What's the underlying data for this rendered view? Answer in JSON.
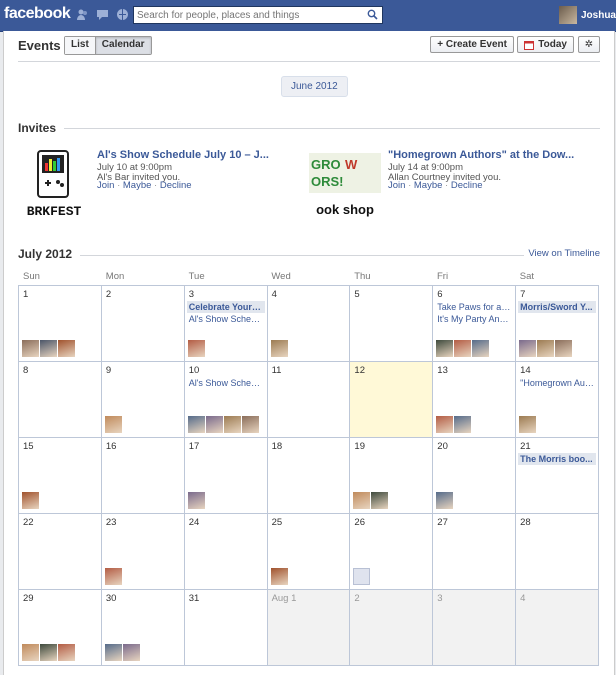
{
  "topbar": {
    "logo": "facebook",
    "search_placeholder": "Search for people, places and things",
    "profile_name": "Joshua",
    "icons": [
      "friend-requests-icon",
      "messages-icon",
      "notifications-icon",
      "search-icon"
    ]
  },
  "header": {
    "title": "Events",
    "view_list": "List",
    "view_calendar": "Calendar",
    "create_event": "+ Create Event",
    "today": "Today"
  },
  "month_pill": "June 2012",
  "invites": {
    "section_title": "Invites",
    "items": [
      {
        "title": "Al's Show Schedule July 10 – J...",
        "time": "July 10 at 9:00pm",
        "invited_by": "Al's Bar invited you.",
        "join": "Join",
        "maybe": "Maybe",
        "decline": "Decline",
        "thumb_text": "BRKFEST"
      },
      {
        "title": "\"Homegrown Authors\" at the Dow...",
        "time": "July 14 at 9:00pm",
        "invited_by": "Allan Courtney invited you.",
        "join": "Join",
        "maybe": "Maybe",
        "decline": "Decline",
        "thumb_text": "ook shop"
      }
    ]
  },
  "calendar": {
    "section_title": "July 2012",
    "view_timeline": "View on Timeline",
    "weekdays": [
      "Sun",
      "Mon",
      "Tue",
      "Wed",
      "Thu",
      "Fri",
      "Sat"
    ],
    "accent_color": "#3b5998",
    "today_color": "#fff9d7",
    "cells": [
      {
        "day": "1",
        "events": [],
        "faces": 3
      },
      {
        "day": "2",
        "events": [],
        "faces": 0
      },
      {
        "day": "3",
        "events": [
          {
            "label": "Celebrate Your I...",
            "hl": true
          },
          {
            "label": "Al's Show Schedu...",
            "hl": false
          }
        ],
        "faces": 1
      },
      {
        "day": "4",
        "events": [],
        "faces": 1
      },
      {
        "day": "5",
        "events": [],
        "faces": 0
      },
      {
        "day": "6",
        "events": [
          {
            "label": "Take Paws for a ...",
            "hl": false
          },
          {
            "label": "It's My Party And ...",
            "hl": false
          }
        ],
        "faces": 3
      },
      {
        "day": "7",
        "events": [
          {
            "label": "Morris/Sword Y...",
            "hl": true
          }
        ],
        "faces": 3
      },
      {
        "day": "8",
        "events": [],
        "faces": 0
      },
      {
        "day": "9",
        "events": [],
        "faces": 1
      },
      {
        "day": "10",
        "events": [
          {
            "label": "Al's Show Schedu...",
            "hl": false
          }
        ],
        "faces": 4
      },
      {
        "day": "11",
        "events": [],
        "faces": 0
      },
      {
        "day": "12",
        "events": [],
        "faces": 0,
        "today": true
      },
      {
        "day": "13",
        "events": [],
        "faces": 2
      },
      {
        "day": "14",
        "events": [
          {
            "label": "\"Homegrown Aut...",
            "hl": false
          }
        ],
        "faces": 1
      },
      {
        "day": "15",
        "events": [],
        "faces": 1
      },
      {
        "day": "16",
        "events": [],
        "faces": 0
      },
      {
        "day": "17",
        "events": [],
        "faces": 1
      },
      {
        "day": "18",
        "events": [],
        "faces": 0
      },
      {
        "day": "19",
        "events": [],
        "faces": 2
      },
      {
        "day": "20",
        "events": [],
        "faces": 1
      },
      {
        "day": "21",
        "events": [
          {
            "label": "The Morris boo...",
            "hl": true
          }
        ],
        "faces": 0
      },
      {
        "day": "22",
        "events": [],
        "faces": 0
      },
      {
        "day": "23",
        "events": [],
        "faces": 1
      },
      {
        "day": "24",
        "events": [],
        "faces": 0
      },
      {
        "day": "25",
        "events": [],
        "faces": 1
      },
      {
        "day": "26",
        "events": [],
        "faces": 1,
        "blank_face": true
      },
      {
        "day": "27",
        "events": [],
        "faces": 0
      },
      {
        "day": "28",
        "events": [],
        "faces": 0
      },
      {
        "day": "29",
        "events": [],
        "faces": 3
      },
      {
        "day": "30",
        "events": [],
        "faces": 2
      },
      {
        "day": "31",
        "events": [],
        "faces": 0
      },
      {
        "day": "Aug 1",
        "events": [],
        "faces": 0,
        "other": true
      },
      {
        "day": "2",
        "events": [],
        "faces": 0,
        "other": true
      },
      {
        "day": "3",
        "events": [],
        "faces": 0,
        "other": true
      },
      {
        "day": "4",
        "events": [],
        "faces": 0,
        "other": true
      }
    ]
  }
}
